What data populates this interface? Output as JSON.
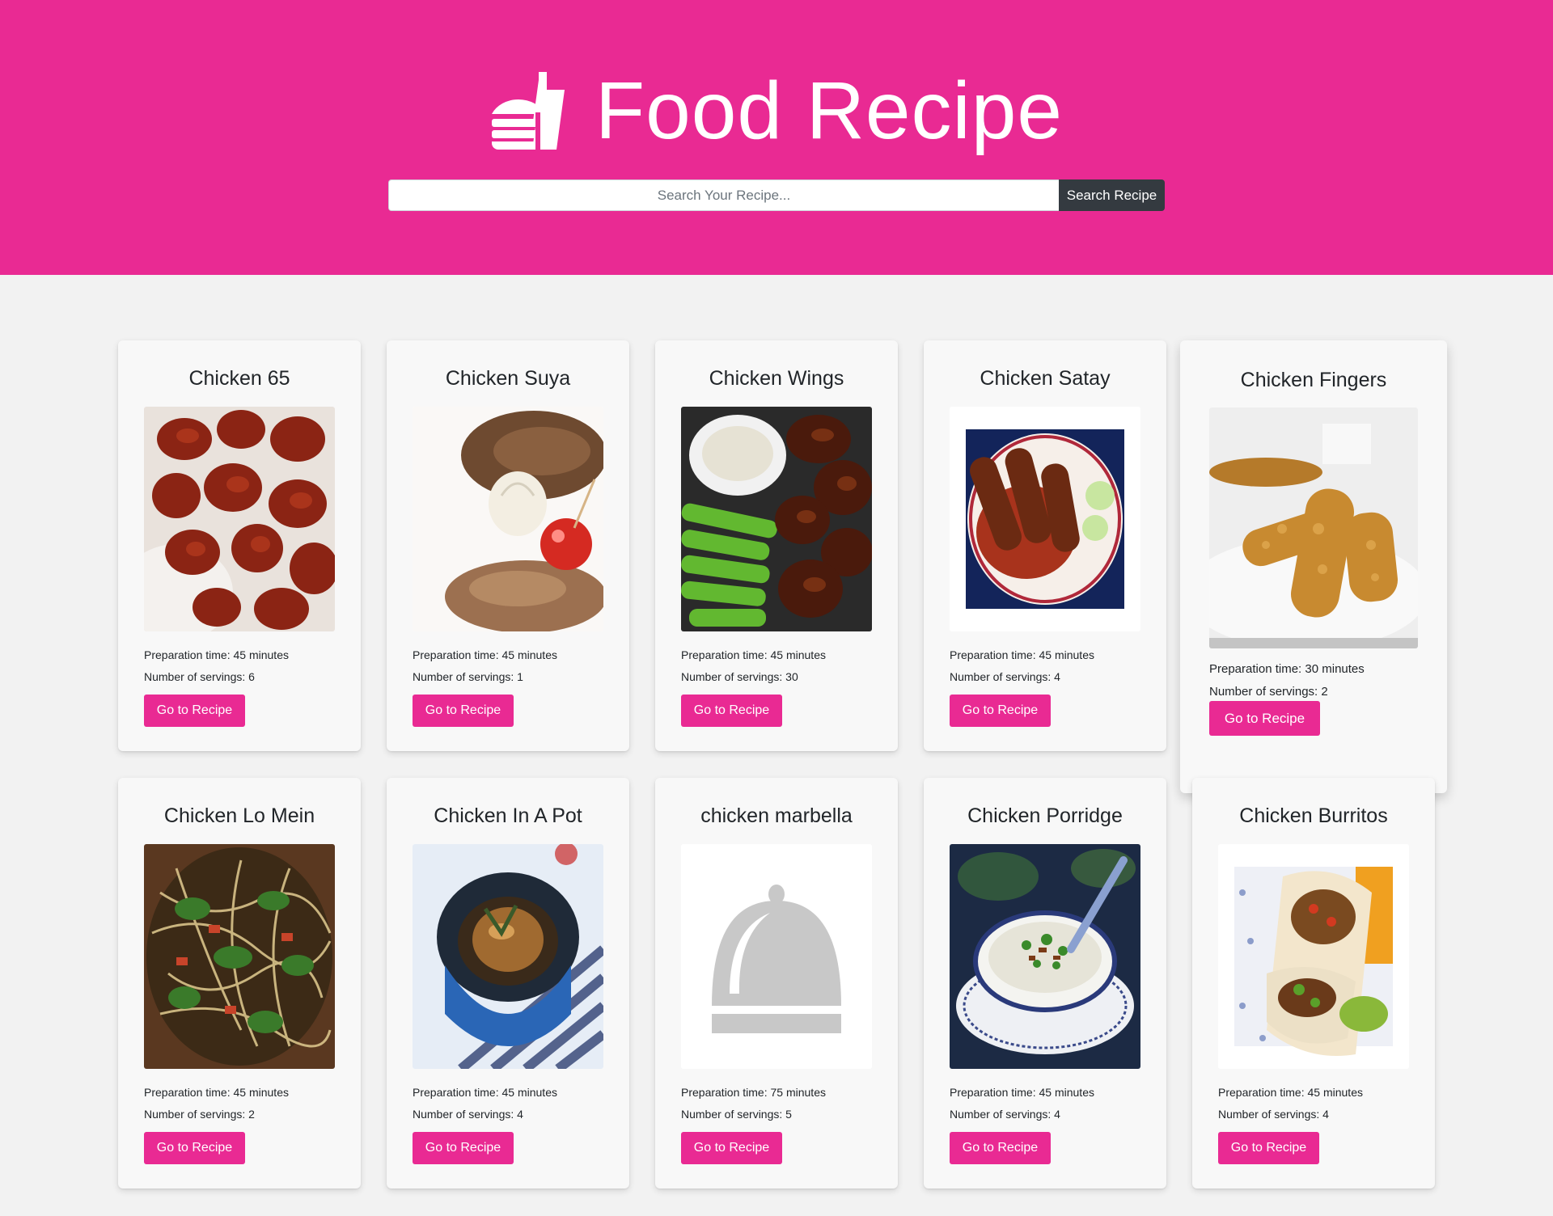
{
  "header": {
    "title": "Food Recipe",
    "logo_icon": "burger-soda-icon",
    "background": "#e92a93"
  },
  "search": {
    "placeholder": "Search Your Recipe...",
    "value": "",
    "button_label": "Search Recipe"
  },
  "colors": {
    "accent": "#e92a93",
    "button_dark": "#343a40",
    "page_bg": "#f2f2f2"
  },
  "recipes": [
    {
      "title": "Chicken 65",
      "prep": "Preparation time: 45 minutes",
      "servings": "Number of servings: 6",
      "button": "Go to Recipe",
      "image": "fried-chicken-photo"
    },
    {
      "title": "Chicken Suya",
      "prep": "Preparation time: 45 minutes",
      "servings": "Number of servings: 1",
      "button": "Go to Recipe",
      "image": "grilled-chicken-onion-tomato-photo"
    },
    {
      "title": "Chicken Wings",
      "prep": "Preparation time: 45 minutes",
      "servings": "Number of servings: 30",
      "button": "Go to Recipe",
      "image": "wings-celery-dip-photo"
    },
    {
      "title": "Chicken Satay",
      "prep": "Preparation time: 45 minutes",
      "servings": "Number of servings: 4",
      "button": "Go to Recipe",
      "image": "satay-plate-photo"
    },
    {
      "title": "Chicken Fingers",
      "prep": "Preparation time: 30 minutes",
      "servings": "Number of servings: 2",
      "button": "Go to Recipe",
      "image": "chicken-fingers-photo"
    },
    {
      "title": "Chicken Lo Mein",
      "prep": "Preparation time: 45 minutes",
      "servings": "Number of servings: 2",
      "button": "Go to Recipe",
      "image": "lo-mein-noodles-photo"
    },
    {
      "title": "Chicken In A Pot",
      "prep": "Preparation time: 45 minutes",
      "servings": "Number of servings: 4",
      "button": "Go to Recipe",
      "image": "chicken-pot-photo"
    },
    {
      "title": "chicken marbella",
      "prep": "Preparation time: 75 minutes",
      "servings": "Number of servings: 5",
      "button": "Go to Recipe",
      "image": "cloche-placeholder-icon"
    },
    {
      "title": "Chicken Porridge",
      "prep": "Preparation time: 45 minutes",
      "servings": "Number of servings: 4",
      "button": "Go to Recipe",
      "image": "porridge-bowl-photo"
    },
    {
      "title": "Chicken Burritos",
      "prep": "Preparation time: 45 minutes",
      "servings": "Number of servings: 4",
      "button": "Go to Recipe",
      "image": "burrito-photo"
    }
  ]
}
